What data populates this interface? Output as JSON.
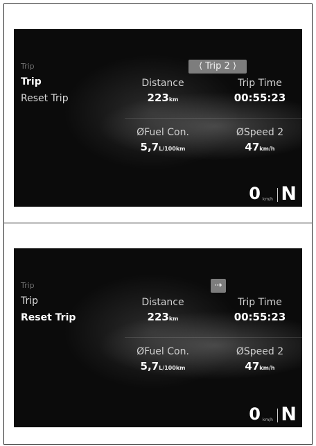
{
  "panels": [
    {
      "menu": {
        "title": "Trip",
        "items": [
          {
            "label": "Trip"
          },
          {
            "label": "Reset Trip"
          }
        ]
      },
      "tab": {
        "label": "⟨ Trip 2 ⟩"
      },
      "stats": {
        "distance": {
          "label": "Distance",
          "value": "223",
          "unit": "km"
        },
        "trip_time": {
          "label": "Trip Time",
          "value": "00:55:23"
        },
        "fuel": {
          "label": "ØFuel Con.",
          "value": "5,7",
          "unit": "L/100km"
        },
        "speed": {
          "label": "ØSpeed 2",
          "value": "47",
          "unit": "km/h"
        }
      },
      "speedometer": {
        "value": "0",
        "unit": "km/h"
      },
      "gear": "N"
    },
    {
      "menu": {
        "title": "Trip",
        "items": [
          {
            "label": "Trip"
          },
          {
            "label": "Reset Trip"
          }
        ]
      },
      "tab": {
        "icon": "enter-arrow-icon",
        "label": "⇢"
      },
      "stats": {
        "distance": {
          "label": "Distance",
          "value": "223",
          "unit": "km"
        },
        "trip_time": {
          "label": "Trip Time",
          "value": "00:55:23"
        },
        "fuel": {
          "label": "ØFuel Con.",
          "value": "5,7",
          "unit": "L/100km"
        },
        "speed": {
          "label": "ØSpeed 2",
          "value": "47",
          "unit": "km/h"
        }
      },
      "speedometer": {
        "value": "0",
        "unit": "km/h"
      },
      "gear": "N"
    }
  ],
  "colors": {
    "screen_bg": "#0b0b0b",
    "tab_bg": "#7d7d7d",
    "text_white": "#ffffff"
  }
}
